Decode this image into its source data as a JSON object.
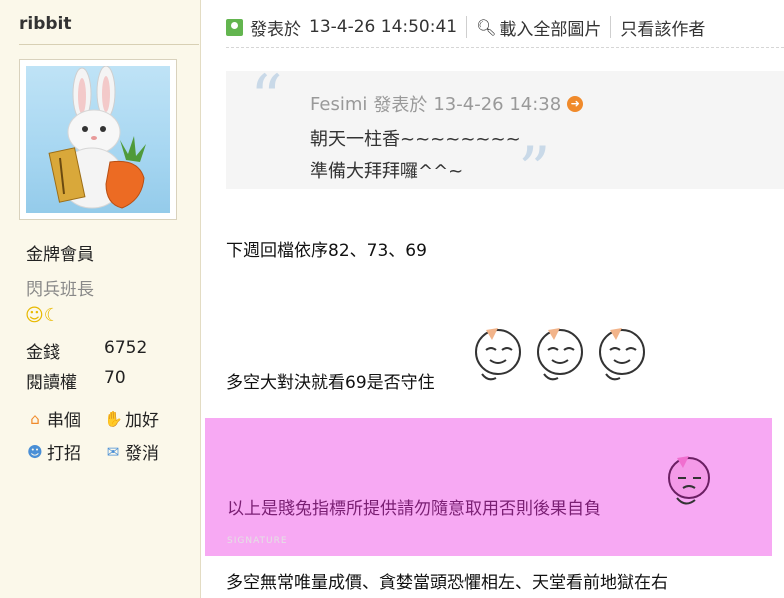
{
  "sidebar": {
    "username": "ribbit",
    "rank": "金牌會員",
    "subrank": "閃兵班長",
    "stats": [
      {
        "label": "金錢",
        "value": "6752"
      },
      {
        "label": "閱讀權",
        "value": "70"
      }
    ],
    "actions": [
      {
        "icon": "home-icon",
        "label": "串個"
      },
      {
        "icon": "handshake-icon",
        "label": "加好"
      },
      {
        "icon": "chat-icon",
        "label": "打招"
      },
      {
        "icon": "mail-icon",
        "label": "發消"
      }
    ]
  },
  "post": {
    "posted_label": "發表於",
    "timestamp": "13-4-26 14:50:41",
    "load_images": "載入全部圖片",
    "author_only": "只看該作者",
    "quote": {
      "author": "Fesimi",
      "posted_label": "發表於",
      "timestamp": "13-4-26 14:38",
      "lines": [
        "朝天一柱香~~~~~~~~",
        "準備大拜拜囉^^~"
      ]
    },
    "body": [
      "下週回檔依序82、73、69",
      "多空大對決就看69是否守住"
    ],
    "signature": {
      "text": "以上是賤兔指標所提供請勿隨意取用否則後果自負",
      "label": "SIGNATURE"
    },
    "footer": "多空無常唯量成價、貪婪當頭恐懼相左、天堂看前地獄在右"
  },
  "colors": {
    "sidebar_bg": "#fbf8ea",
    "signature_bg": "#f7a9f3",
    "quote_bg": "#f5f5f5"
  }
}
